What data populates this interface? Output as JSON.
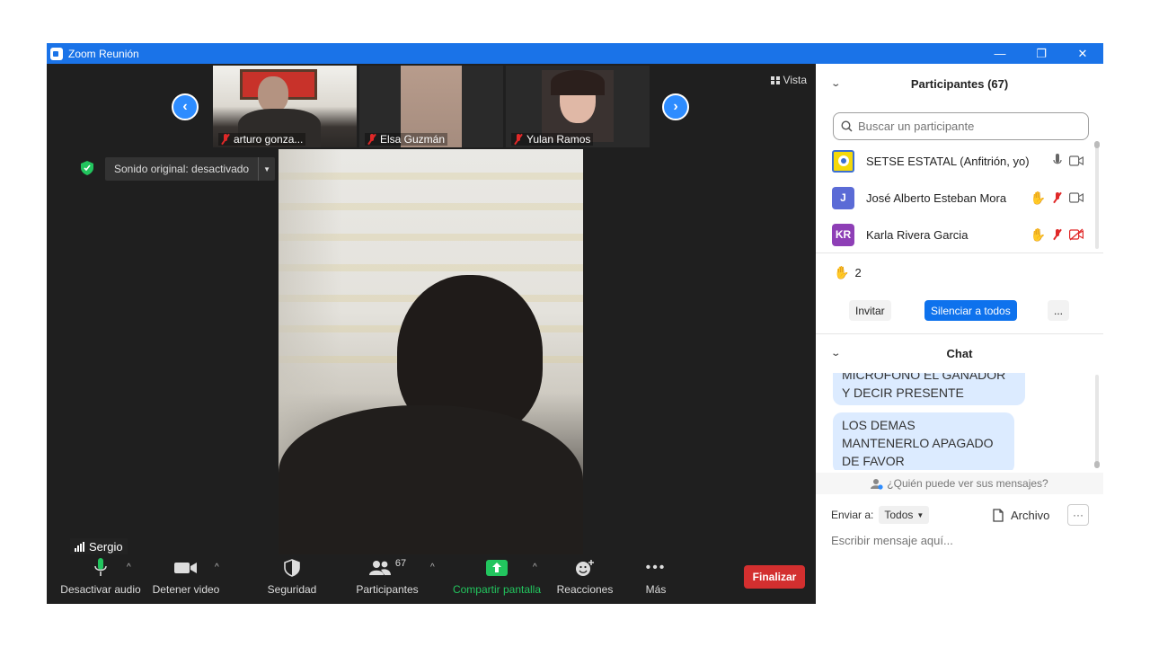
{
  "window": {
    "title": "Zoom Reunión",
    "controls": [
      "—",
      "❐",
      "✕"
    ]
  },
  "meeting": {
    "view_label": "Vista",
    "original_sound": "Sonido original: desactivado",
    "thumbnails": [
      {
        "name": "arturo gonza..."
      },
      {
        "name": "Elsa Guzmán"
      },
      {
        "name": "Yulan Ramos"
      }
    ],
    "active_speaker": "Sergio"
  },
  "toolbar": {
    "audio": "Desactivar audio",
    "video": "Detener video",
    "security": "Seguridad",
    "participants": "Participantes",
    "participants_count": "67",
    "share": "Compartir pantalla",
    "reactions": "Reacciones",
    "more": "Más",
    "end": "Finalizar"
  },
  "participants_panel": {
    "title": "Participantes (67)",
    "search_placeholder": "Buscar un participante",
    "list": [
      {
        "name": "SETSE ESTATAL (Anfitrión, yo)",
        "avatar": "",
        "color": "#f5d90a"
      },
      {
        "name": "José Alberto Esteban Mora",
        "avatar": "J",
        "color": "#5b6bd6"
      },
      {
        "name": "Karla Rivera Garcia",
        "avatar": "KR",
        "color": "#8e3fb6"
      }
    ],
    "raised_hands": "2",
    "invite": "Invitar",
    "mute_all": "Silenciar a todos",
    "more": "..."
  },
  "chat_panel": {
    "title": "Chat",
    "messages": [
      "MICRÓFONO EL GANADOR Y DECIR PRESENTE",
      "LOS DEMAS MANTENERLO APAGADO DE FAVOR"
    ],
    "who_sees": "¿Quién puede ver sus mensajes?",
    "send_to_label": "Enviar a:",
    "send_to_value": "Todos",
    "file": "Archivo",
    "input_placeholder": "Escribir mensaje aquí..."
  },
  "colors": {
    "accent": "#0e72ed",
    "title_bar": "#1a73e8",
    "end_button": "#d32f2f",
    "share_green": "#22c55e",
    "meeting_bg": "#1f1f1f"
  }
}
